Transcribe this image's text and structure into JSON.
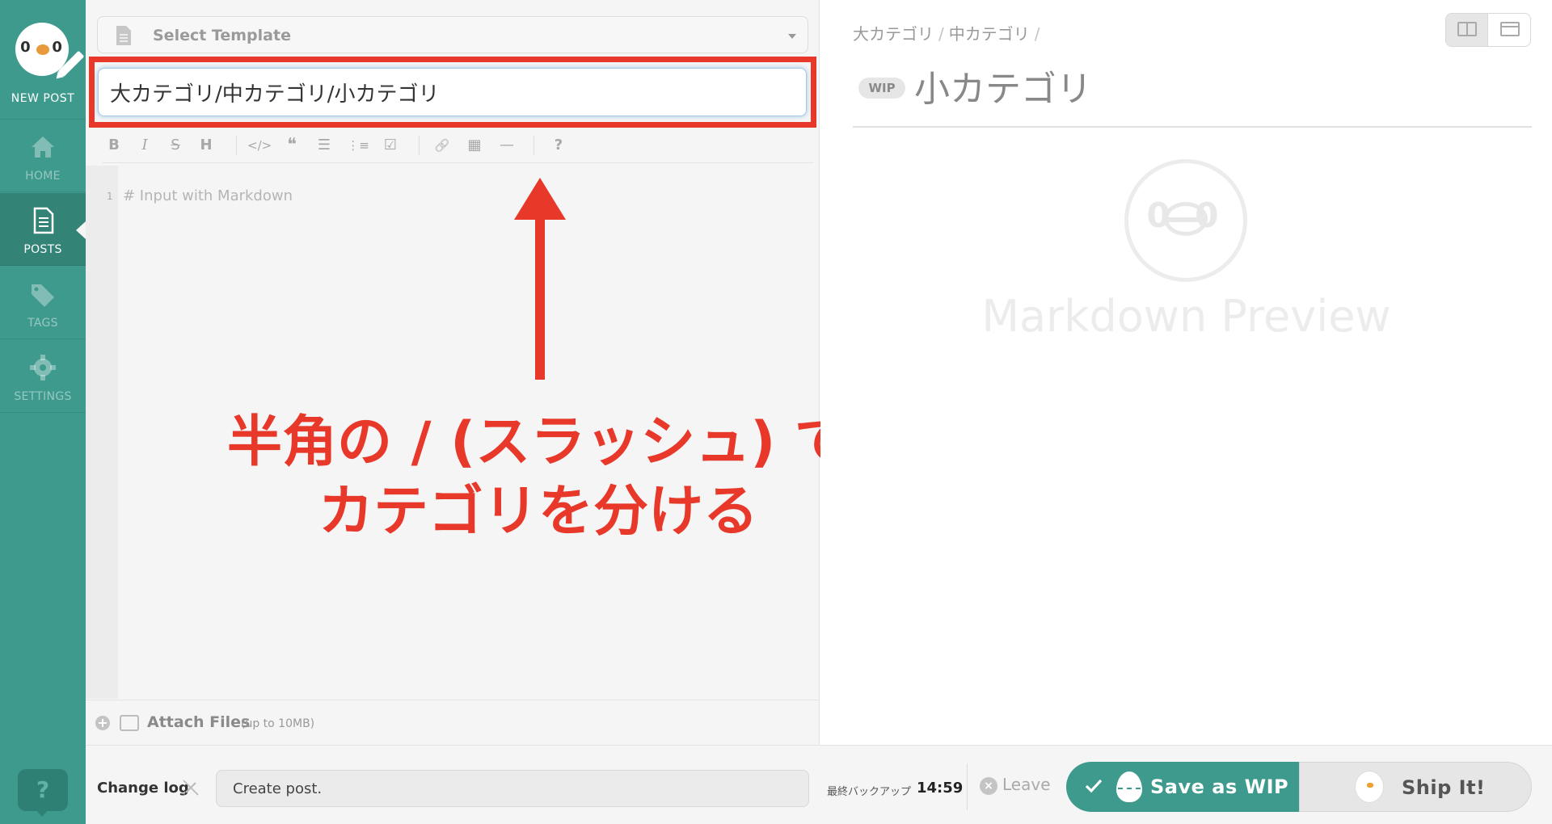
{
  "sidebar": {
    "new_post_label": "NEW POST",
    "items": [
      {
        "label": "HOME",
        "icon": "home-icon"
      },
      {
        "label": "POSTS",
        "icon": "document-icon",
        "active": true
      },
      {
        "label": "TAGS",
        "icon": "tag-icon"
      },
      {
        "label": "SETTINGS",
        "icon": "gear-icon"
      }
    ],
    "help_label": "?"
  },
  "editor": {
    "template_placeholder": "Select Template",
    "title_value": "大カテゴリ/中カテゴリ/小カテゴリ",
    "toolbar": [
      "B",
      "I",
      "S",
      "H",
      "</>",
      "❝",
      "☰",
      "⋮≡",
      "☑",
      "🔗",
      "▦",
      "—",
      "?"
    ],
    "line_number": "1",
    "body_placeholder": "# Input with Markdown",
    "attach_label": "Attach Files",
    "attach_note": "(up to 10MB)"
  },
  "annotation": {
    "line1": "半角の / (スラッシュ) で",
    "line2": "カテゴリを分ける"
  },
  "preview": {
    "breadcrumbs": [
      "大カテゴリ",
      "中カテゴリ"
    ],
    "crumb_sep": "/",
    "wip_badge": "WIP",
    "title": "小カテゴリ",
    "placeholder_face": "0 0",
    "placeholder_text": "Markdown Preview"
  },
  "footer": {
    "changelog_label": "Change log",
    "changelog_value": "Create post.",
    "backup_label": "最終バックアップ",
    "backup_time": "14:59",
    "leave_label": "Leave",
    "save_wip_label": "Save as WIP",
    "ship_label": "Ship It!"
  },
  "colors": {
    "brand": "#3f9a8e",
    "annotation": "#e8382a"
  }
}
